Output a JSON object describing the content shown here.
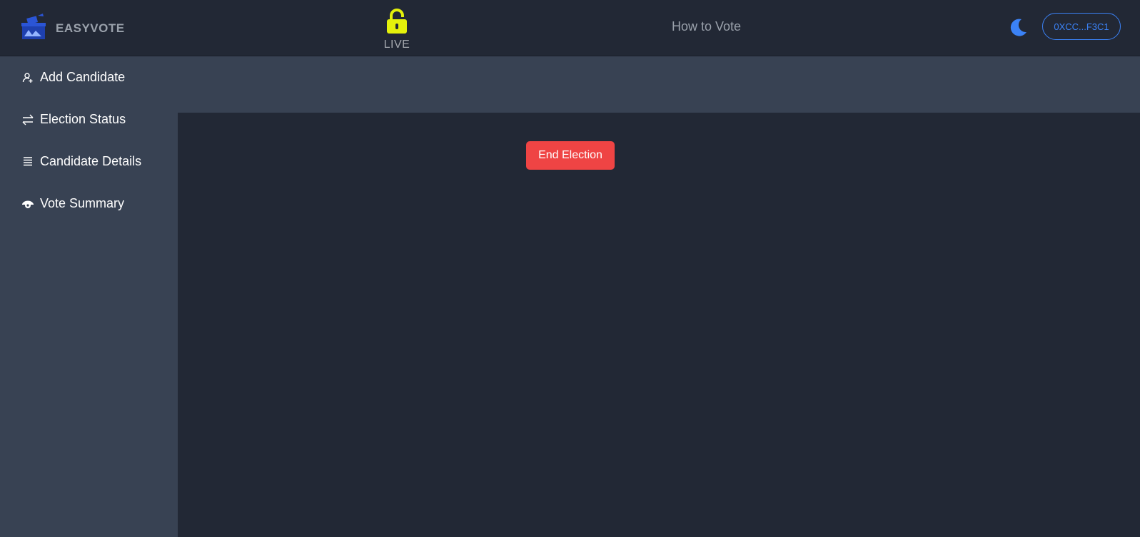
{
  "header": {
    "brand": "EASYVOTE",
    "status_label": "LIVE",
    "how_to_vote": "How to Vote",
    "wallet_address": "0XCC...F3C1"
  },
  "sidebar": {
    "items": [
      {
        "label": "Add Candidate",
        "icon": "user-add-icon"
      },
      {
        "label": "Election Status",
        "icon": "swap-arrows-icon"
      },
      {
        "label": "Candidate Details",
        "icon": "list-icon"
      },
      {
        "label": "Vote Summary",
        "icon": "eye-icon"
      }
    ]
  },
  "main": {
    "end_election_label": "End Election"
  },
  "colors": {
    "background": "#222835",
    "sidebar": "#384253",
    "accent_blue": "#3b82f6",
    "lock_yellow": "#e4f10b",
    "danger": "#ef4444"
  }
}
